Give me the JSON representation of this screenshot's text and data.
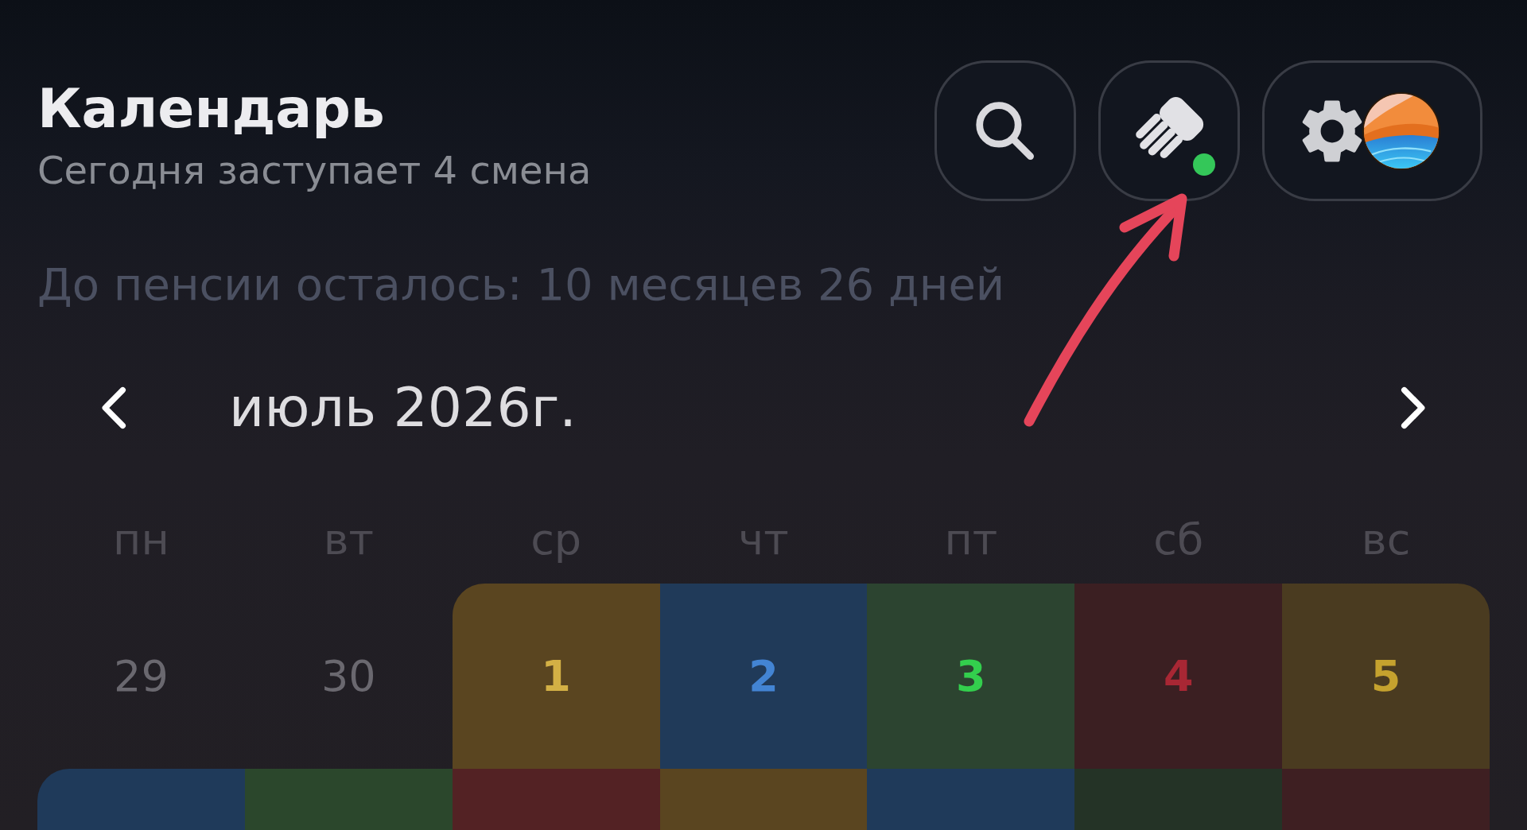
{
  "header": {
    "title": "Календарь",
    "subtitle": "Сегодня заступает 4 смена"
  },
  "actions": [
    {
      "kind": "search",
      "indicator": false
    },
    {
      "kind": "shifts",
      "indicator": true
    },
    {
      "kind": "settings",
      "indicator": false
    }
  ],
  "retirement": "До пенсии осталось: 10 месяцев 26 дней",
  "month_nav": {
    "label": "июль 2026г."
  },
  "calendar": {
    "weekdays": [
      "пн",
      "вт",
      "ср",
      "чт",
      "пт",
      "сб",
      "вс"
    ],
    "weeks": [
      [
        {
          "day": "29",
          "other_month": true
        },
        {
          "day": "30",
          "other_month": true
        },
        {
          "day": "1",
          "other_month": false,
          "color": "#5a4520"
        },
        {
          "day": "2",
          "other_month": false,
          "color": "#203a59"
        },
        {
          "day": "3",
          "other_month": false,
          "color": "#2c4430"
        },
        {
          "day": "4",
          "other_month": false,
          "color": "#3b1f22"
        },
        {
          "day": "5",
          "other_month": false,
          "color": "#4a3b20"
        }
      ],
      [
        {
          "other_month": false,
          "color": "#1f3a5a"
        },
        {
          "other_month": false,
          "color": "#2b472c"
        },
        {
          "other_month": false,
          "color": "#532224"
        },
        {
          "other_month": false,
          "color": "#5a4520"
        },
        {
          "other_month": false,
          "color": "#1f3a5a"
        },
        {
          "other_month": false,
          "color": "#243326"
        },
        {
          "other_month": false,
          "color": "#3e1f22"
        }
      ]
    ]
  }
}
